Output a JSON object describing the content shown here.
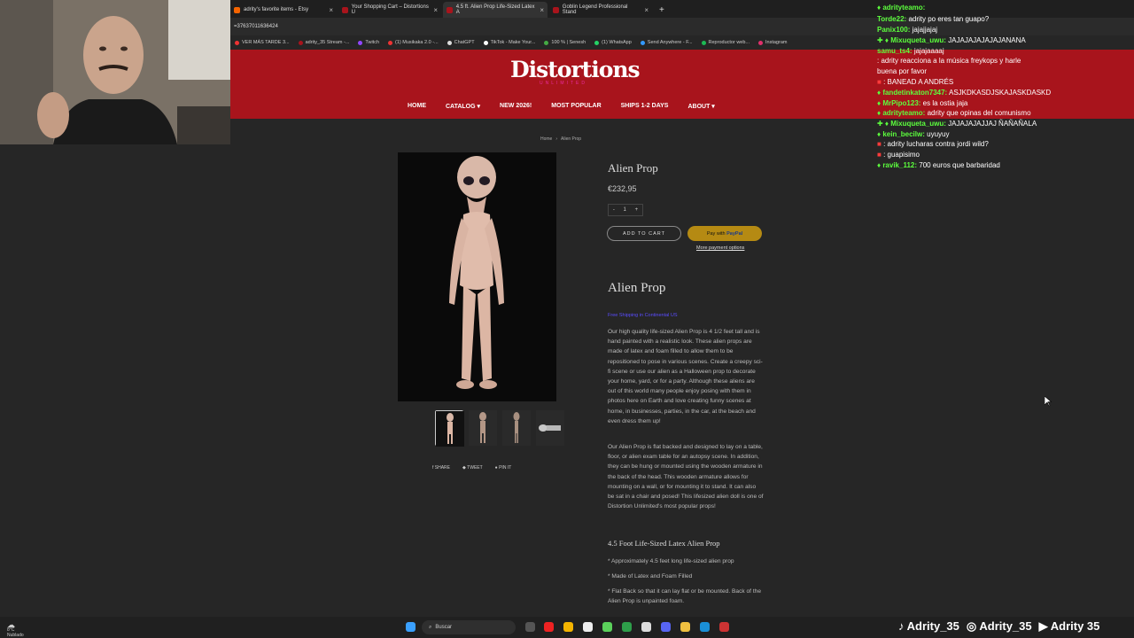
{
  "tabs": [
    {
      "label": "adrity's favorite items - Etsy",
      "color": "#f56400"
    },
    {
      "label": "Your Shopping Cart – Distortions U",
      "color": "#a8141c"
    },
    {
      "label": "4.5 ft. Alien Prop Life-Sized Latex A",
      "color": "#a8141c"
    },
    {
      "label": "Goblin Legend Professional Stand",
      "color": "#a8141c"
    }
  ],
  "address": "=37637011636424",
  "bookmarks": [
    {
      "label": "VER MÁS TARDE 3...",
      "color": "#e33"
    },
    {
      "label": "adrity_35 Stream -...",
      "color": "#a8141c"
    },
    {
      "label": "Twitch",
      "color": "#9146ff"
    },
    {
      "label": "(1) Musikaka 2.0 -...",
      "color": "#e33"
    },
    {
      "label": "ChatGPT",
      "color": "#ddd"
    },
    {
      "label": "TikTok - Make Your...",
      "color": "#fff"
    },
    {
      "label": "100 % | Senesh",
      "color": "#4a4"
    },
    {
      "label": "(1) WhatsApp",
      "color": "#25d366"
    },
    {
      "label": "Send Anywhere - F...",
      "color": "#39f"
    },
    {
      "label": "Reproductor web...",
      "color": "#1db954"
    },
    {
      "label": "Instagram",
      "color": "#e1306c"
    }
  ],
  "site": {
    "logo": "Distortions",
    "logo_sub": "UNLIMITED",
    "nav": [
      "HOME",
      "CATALOG",
      "NEW 2026!",
      "MOST POPULAR",
      "SHIPS 1-2 DAYS",
      "ABOUT"
    ]
  },
  "breadcrumb": {
    "home": "Home",
    "current": "Alien Prop",
    "sep": "›"
  },
  "product": {
    "title": "Alien Prop",
    "price": "€232,95",
    "qty_minus": "-",
    "qty": "1",
    "qty_plus": "+",
    "add_to_cart": "ADD TO CART",
    "pay_with": "Pay with",
    "pay_brand": "PayPal",
    "more_options": "More payment options",
    "share": [
      "SHARE",
      "TWEET",
      "PIN IT"
    ],
    "desc_title": "Alien Prop",
    "free_shipping": "Free Shipping in Continental US",
    "desc1": "Our high quality life-sized Alien Prop is 4 1/2 feet tall and is hand painted with a realistic look. These alien props are made of latex and foam filled to allow them to be repositioned to pose in various scenes. Create a creepy sci-fi scene or use our alien as a Halloween prop to decorate your home, yard, or for a party. Although these aliens are out of this world many people enjoy posing with them in photos here on Earth and love creating funny scenes at home, in businesses, parties, in the car, at the beach and even dress them up!",
    "desc2": "Our Alien Prop is flat backed and designed to lay on a table, floor, or alien exam table for an autopsy scene. In addition, they can be hung or mounted using the wooden armature in the back of the head. This wooden armature allows for mounting on a wall, or for mounting it to stand. It can also be sat in a chair and posed! This lifesized alien doll is one of Distortion Unlimited's most popular props!",
    "subhead": "4.5 Foot Life-Sized Latex Alien Prop",
    "bullets": [
      "* Approximately 4.5 feet long life-sized alien prop",
      "* Made of Latex and Foam Filled",
      "* Flat Back so that it can lay flat or be mounted. Back of the Alien Prop is unpainted foam."
    ]
  },
  "chat": [
    {
      "user": "adrityteamo:",
      "msg": "",
      "color": "#5cff3d"
    },
    {
      "user": "Torde22:",
      "msg": "adrity po eres tan guapo?",
      "color": "#5cff3d"
    },
    {
      "user": "Panix100:",
      "msg": "jajajjajaj",
      "color": "#5cff3d"
    },
    {
      "user": "Mixuqueta_uwu:",
      "msg": "JAJAJAJAJAJAJANANA",
      "color": "#5cff3d"
    },
    {
      "user": "samu_ts4:",
      "msg": "jajajaaaaj",
      "color": "#5cff3d"
    },
    {
      "user": "",
      "msg": ": adrity reacciona a la música freykops y harle",
      "color": "#ff3b3b"
    },
    {
      "user": "",
      "msg": "buena por favor",
      "color": "#fff"
    },
    {
      "user": "",
      "msg": ": BANEAD A ANDRÉS",
      "color": "#ff3b3b"
    },
    {
      "user": "fandetinkaton7347:",
      "msg": "ASJKDKASDJSKAJASKDASKD",
      "color": "#5cff3d"
    },
    {
      "user": "MrPipo123:",
      "msg": "es la ostia jaja",
      "color": "#5cff3d"
    },
    {
      "user": "adrityteamo:",
      "msg": "adrity que opinas del comunismo",
      "color": "#5cff3d"
    },
    {
      "user": "Mixuqueta_uwu:",
      "msg": "JAJAJAJAJJAJ ÑAÑAÑALA",
      "color": "#5cff3d"
    },
    {
      "user": "kein_becilw:",
      "msg": "uyuyuy",
      "color": "#5cff3d"
    },
    {
      "user": "",
      "msg": ": adrity lucharas contra jordi wild?",
      "color": "#ff3b3b"
    },
    {
      "user": "",
      "msg": ": guapisimo",
      "color": "#ff3b3b"
    },
    {
      "user": "ravik_112:",
      "msg": "700 euros que barbaridad",
      "color": "#5cff3d"
    }
  ],
  "taskbar": {
    "search": "Buscar",
    "weather_temp": "8°C",
    "weather_desc": "Nublado"
  },
  "social": [
    "Adrity_35",
    "Adrity_35",
    "Adrity 35"
  ]
}
